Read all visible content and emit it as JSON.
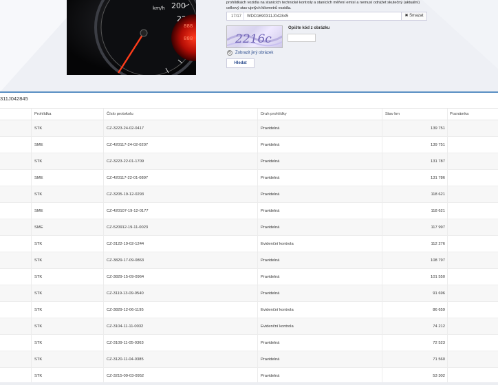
{
  "form": {
    "description": "prohlídkách vozidla na stanicích technické kontroly a stanicích měření emisí a nemusí odrážet skutečný (aktuální) celkový stav ujetých kilometrů vozidla.",
    "vin_counter": "17/17",
    "vin_value": "WDD1690311J042845",
    "clear_label": "Smazat",
    "captcha_text": "2216c",
    "captcha_label": "Opište kód z obrázku",
    "refresh_label": "Zobrazit jiný obrázek",
    "search_label": "Hledat"
  },
  "results": {
    "vin_title": "311J042845",
    "columns": [
      "Prohlídka",
      "Číslo protokolu",
      "Druh prohlídky",
      "Stav km",
      "Poznámka"
    ],
    "rows": [
      {
        "type": "STK",
        "protocol": "CZ-3223-24-02-0417",
        "kind": "Pravidelná",
        "km": "139 751",
        "note": ""
      },
      {
        "type": "SME",
        "protocol": "CZ-420117-24-02-0207",
        "kind": "Pravidelná",
        "km": "139 751",
        "note": ""
      },
      {
        "type": "STK",
        "protocol": "CZ-3223-22-01-1709",
        "kind": "Pravidelná",
        "km": "131 787",
        "note": ""
      },
      {
        "type": "SME",
        "protocol": "CZ-420117-22-01-0897",
        "kind": "Pravidelná",
        "km": "131 786",
        "note": ""
      },
      {
        "type": "STK",
        "protocol": "CZ-3205-19-12-0293",
        "kind": "Pravidelná",
        "km": "118 621",
        "note": ""
      },
      {
        "type": "SME",
        "protocol": "CZ-420107-19-12-0177",
        "kind": "Pravidelná",
        "km": "118 621",
        "note": ""
      },
      {
        "type": "SME",
        "protocol": "CZ-520912-19-11-0023",
        "kind": "Pravidelná",
        "km": "117 997",
        "note": ""
      },
      {
        "type": "STK",
        "protocol": "CZ-3122-19-02-1244",
        "kind": "Evidenční kontrola",
        "km": "112 276",
        "note": ""
      },
      {
        "type": "STK",
        "protocol": "CZ-3829-17-09-0863",
        "kind": "Pravidelná",
        "km": "108 797",
        "note": ""
      },
      {
        "type": "STK",
        "protocol": "CZ-3829-15-09-0964",
        "kind": "Pravidelná",
        "km": "101 550",
        "note": ""
      },
      {
        "type": "STK",
        "protocol": "CZ-3119-13-09-0540",
        "kind": "Pravidelná",
        "km": "91 696",
        "note": ""
      },
      {
        "type": "STK",
        "protocol": "CZ-3829-12-06-1195",
        "kind": "Evidenční kontrola",
        "km": "86 659",
        "note": ""
      },
      {
        "type": "STK",
        "protocol": "CZ-3104-11-11-0032",
        "kind": "Evidenční kontrola",
        "km": "74 212",
        "note": ""
      },
      {
        "type": "STK",
        "protocol": "CZ-3109-11-05-0363",
        "kind": "Pravidelná",
        "km": "72 523",
        "note": ""
      },
      {
        "type": "STK",
        "protocol": "CZ-3120-11-04-0385",
        "kind": "Pravidelná",
        "km": "71 560",
        "note": ""
      },
      {
        "type": "STK",
        "protocol": "CZ-3215-09-03-0952",
        "kind": "Pravidelná",
        "km": "53 302",
        "note": ""
      }
    ]
  },
  "colors": {
    "accent": "#5a8fc3",
    "link": "#2a4b8d",
    "row_alt": "#f7f7f7",
    "banner_bg": "#eef0f5"
  },
  "icons": {
    "clear": "x-icon",
    "refresh": "refresh-icon"
  }
}
